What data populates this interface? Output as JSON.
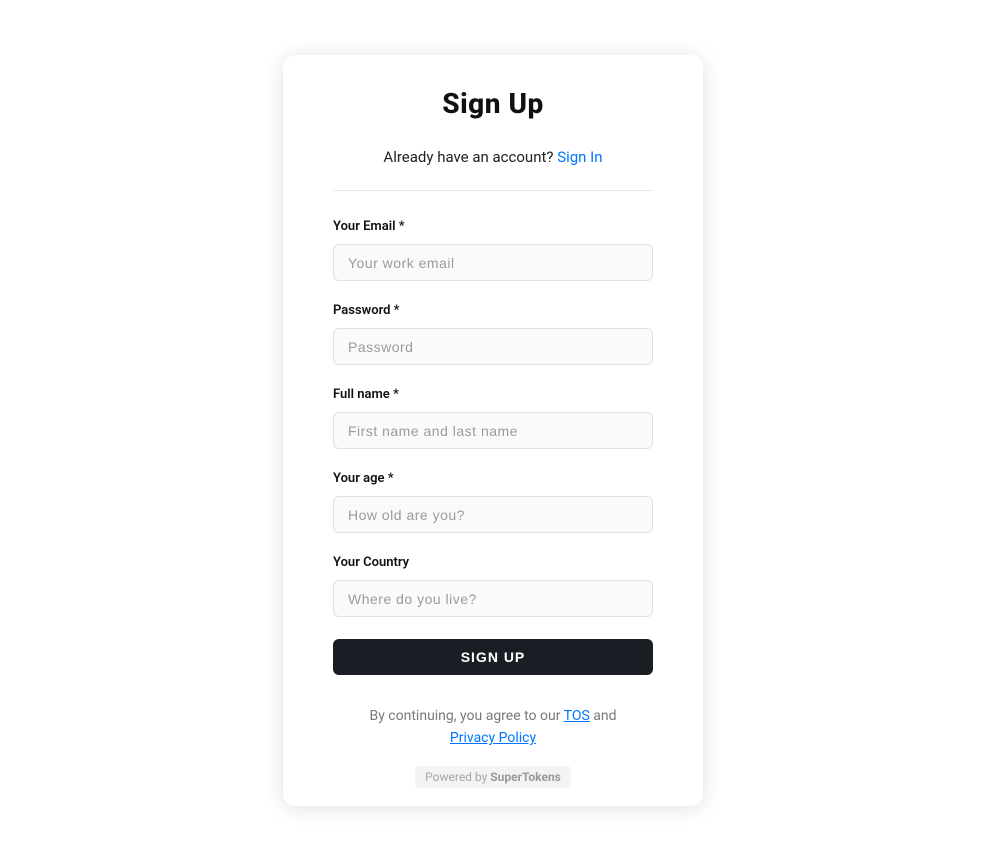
{
  "header": {
    "title": "Sign Up",
    "subtitle_prefix": "Already have an account? ",
    "signin_link": "Sign In"
  },
  "fields": {
    "email": {
      "label": "Your Email *",
      "placeholder": "Your work email"
    },
    "password": {
      "label": "Password *",
      "placeholder": "Password"
    },
    "fullname": {
      "label": "Full name *",
      "placeholder": "First name and last name"
    },
    "age": {
      "label": "Your age *",
      "placeholder": "How old are you?"
    },
    "country": {
      "label": "Your Country",
      "placeholder": "Where do you live?"
    }
  },
  "submit_label": "SIGN UP",
  "footer": {
    "prefix": "By continuing, you agree to our ",
    "tos": "TOS",
    "middle": " and ",
    "privacy": "Privacy Policy"
  },
  "powered": {
    "prefix": "Powered by ",
    "brand": "SuperTokens"
  }
}
